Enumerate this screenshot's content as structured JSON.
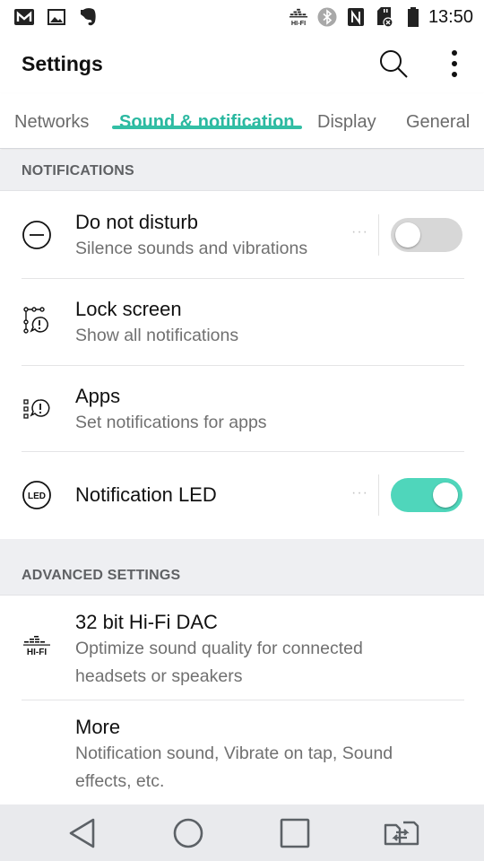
{
  "status_bar": {
    "left_icons": [
      "gmail-icon",
      "gallery-icon",
      "evernote-icon"
    ],
    "right_icons": [
      "hifi-icon",
      "bluetooth-icon",
      "nfc-icon",
      "sd-card-error-icon",
      "battery-icon"
    ],
    "hifi_label": "HI-FI",
    "nfc_label": "N",
    "time": "13:50"
  },
  "app_bar": {
    "title": "Settings",
    "actions": [
      "search-icon",
      "overflow-menu-icon"
    ]
  },
  "tabs": [
    {
      "label": "Networks",
      "active": false
    },
    {
      "label": "Sound & notification",
      "active": true
    },
    {
      "label": "Display",
      "active": false
    },
    {
      "label": "General",
      "active": false
    }
  ],
  "accent_color": "#2ab8a0",
  "sections": {
    "notifications": {
      "header": "NOTIFICATIONS",
      "items": [
        {
          "icon": "do-not-disturb-icon",
          "title": "Do not disturb",
          "subtitle": "Silence sounds and vibrations",
          "toggle": false
        },
        {
          "icon": "lock-screen-notification-icon",
          "title": "Lock screen",
          "subtitle": "Show all notifications"
        },
        {
          "icon": "apps-notification-icon",
          "title": "Apps",
          "subtitle": "Set notifications for apps"
        },
        {
          "icon": "led-icon",
          "icon_text": "LED",
          "title": "Notification LED",
          "toggle": true
        }
      ]
    },
    "advanced": {
      "header": "ADVANCED SETTINGS",
      "items": [
        {
          "icon": "hifi-dac-icon",
          "icon_text": "HI-FI",
          "title": "32 bit Hi-Fi DAC",
          "subtitle_line1": "Optimize sound quality for connected",
          "subtitle_line2": "headsets or speakers"
        },
        {
          "title": "More",
          "subtitle_line1": "Notification sound, Vibrate on tap, Sound",
          "subtitle_line2": "effects, etc."
        }
      ]
    }
  },
  "more_dots": "···",
  "nav_bar": [
    "back-icon",
    "home-icon",
    "recents-icon",
    "dual-window-icon"
  ]
}
